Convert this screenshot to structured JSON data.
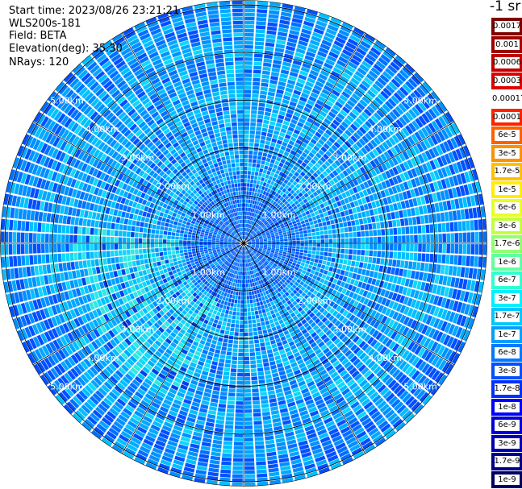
{
  "header": {
    "start_time": "Start time: 2023/08/26 23:21:21",
    "instrument": "WLS200s-181",
    "field": "Field: BETA",
    "elevation": "Elevation(deg): 35.30",
    "nrays": "NRays: 120"
  },
  "chart_data": {
    "type": "heatmap",
    "projection": "polar (PPI)",
    "field": "BETA",
    "elevation_deg": 35.3,
    "nrays": 120,
    "range_rings_km": [
      1,
      2,
      3,
      4,
      5
    ],
    "ring_labels": [
      "1.00km",
      "2.00km",
      "3.00km",
      "4.00km",
      "5.00km"
    ],
    "max_range_km": 5.1,
    "spokes": 12,
    "colorbar": {
      "unit": "-1 sr",
      "labels": [
        "0.0017",
        "0.001",
        "0.0006",
        "0.0003",
        "0.00017",
        "0.0001",
        "6e-5",
        "3e-5",
        "1.7e-5",
        "1e-5",
        "6e-6",
        "3e-6",
        "1.7e-6",
        "1e-6",
        "6e-7",
        "3e-7",
        "1.7e-7",
        "1e-7",
        "6e-8",
        "3e-8",
        "1.7e-8",
        "1e-8",
        "6e-9",
        "3e-9",
        "1.7e-9",
        "1e-9"
      ],
      "colors": [
        "#800000",
        "#a00000",
        "#c00000",
        "#e00000",
        "#ffffff",
        "#ff2000",
        "#ff6000",
        "#ff9000",
        "#ffc000",
        "#ffee00",
        "#e8ff20",
        "#c0ff40",
        "#90ff70",
        "#60ffa0",
        "#30ffd0",
        "#00f0ff",
        "#00c8ff",
        "#00a0ff",
        "#0078ff",
        "#0050ff",
        "#0030ff",
        "#0000ff",
        "#0000d8",
        "#0000b0",
        "#000088",
        "#000060"
      ]
    },
    "typical_value_range": [
      "3e-8",
      "1.7e-7"
    ]
  }
}
